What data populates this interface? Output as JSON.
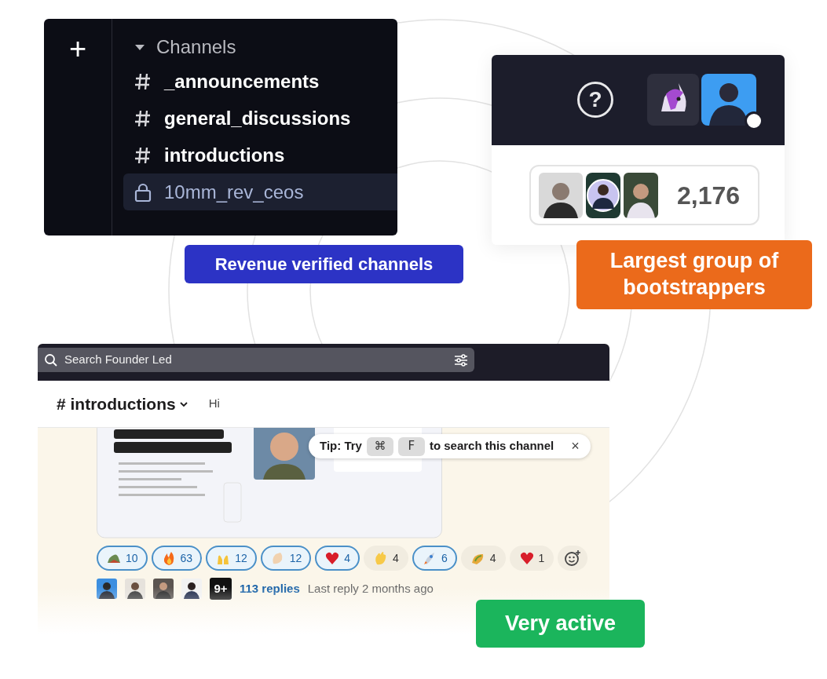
{
  "channels_panel": {
    "new_button": "+",
    "header": "Channels",
    "expanded": true,
    "items": [
      {
        "kind": "public",
        "name": "_announcements",
        "selected": false
      },
      {
        "kind": "public",
        "name": "general_discussions",
        "selected": false
      },
      {
        "kind": "public",
        "name": "introductions",
        "selected": false
      },
      {
        "kind": "private",
        "name": "10mm_rev_ceos",
        "selected": true
      }
    ]
  },
  "badges": [
    {
      "text": "Revenue verified channels",
      "color": "#2c33c5"
    },
    {
      "text": "Largest group of bootstrappers",
      "color": "#eb6a1b"
    },
    {
      "text": "Very active",
      "color": "#1bb55c"
    }
  ],
  "members_panel": {
    "help": "?",
    "online": true,
    "count": "2,176"
  },
  "search": {
    "placeholder": "Search Founder Led"
  },
  "channel_header": {
    "hash": "#",
    "name": "introductions",
    "topic": "Hi"
  },
  "tip": {
    "lead": "Tip: Try",
    "keys": [
      "⌘",
      "F"
    ],
    "tail": "to search this channel",
    "close": "×"
  },
  "reactions": [
    {
      "count": "10",
      "selected": true
    },
    {
      "count": "63",
      "selected": true
    },
    {
      "count": "12",
      "selected": true
    },
    {
      "count": "12",
      "selected": true
    },
    {
      "count": "4",
      "selected": true
    },
    {
      "count": "4",
      "selected": false
    },
    {
      "count": "6",
      "selected": true
    },
    {
      "count": "4",
      "selected": false
    },
    {
      "count": "1",
      "selected": false
    }
  ],
  "thread": {
    "more": "9+",
    "replies": "113 replies",
    "last_reply": "Last reply 2 months ago"
  }
}
